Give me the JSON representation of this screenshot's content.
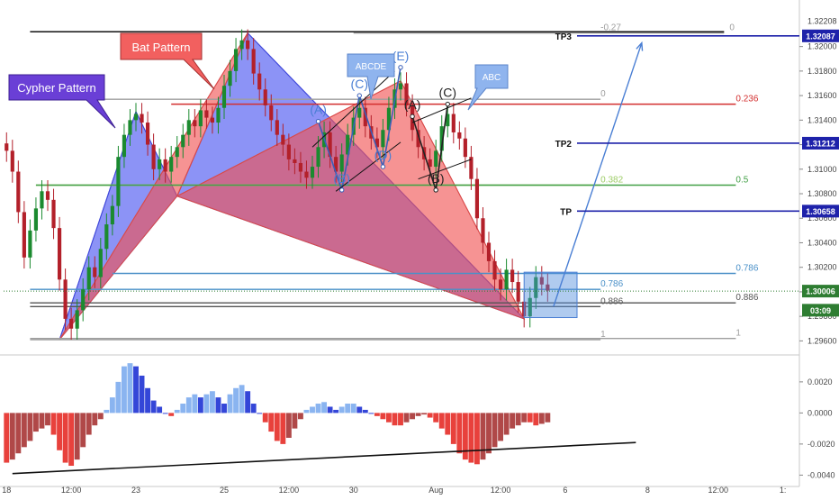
{
  "chart_data": {
    "type": "candlestick",
    "instrument_note": "",
    "price_axis": {
      "ticks": [
        "1.32000",
        "1.31800",
        "1.31600",
        "1.31400",
        "1.31200",
        "1.31000",
        "1.30800",
        "1.30600",
        "1.30400",
        "1.30200",
        "1.30000",
        "1.29800",
        "1.29600"
      ],
      "tick_values": [
        1.32,
        1.318,
        1.316,
        1.314,
        1.312,
        1.31,
        1.308,
        1.306,
        1.304,
        1.302,
        1.3,
        1.298,
        1.296
      ],
      "top_label": "1.32208",
      "range": [
        1.295,
        1.3235
      ]
    },
    "osc_axis": {
      "ticks": [
        "0.0020",
        "0.0000",
        "-0.0020",
        "-0.0040"
      ],
      "tick_values": [
        0.002,
        0.0,
        -0.002,
        -0.004
      ],
      "range": [
        -0.0045,
        0.0035
      ]
    },
    "time_axis": {
      "labels": [
        "18",
        "12:00",
        "23",
        "25",
        "12:00",
        "30",
        "Aug",
        "12:00",
        "6",
        "8",
        "12:00",
        "1:"
      ],
      "label_bars": [
        0,
        11,
        22,
        37,
        48,
        59,
        73,
        84,
        95,
        109,
        121,
        132
      ],
      "total_bars": 135,
      "data_bars": 93
    },
    "price_labels": [
      {
        "text": "1.32087",
        "value": 1.32087,
        "color": "#1e22aa"
      },
      {
        "text": "1.31212",
        "value": 1.31212,
        "color": "#1e22aa"
      },
      {
        "text": "1.30658",
        "value": 1.30658,
        "color": "#1e22aa"
      },
      {
        "text": "1.30006",
        "value": 1.30006,
        "color": "#2e7d32"
      },
      {
        "text": "03:09",
        "value": 1.2985,
        "color": "#2e7d32"
      }
    ],
    "target_lines": [
      {
        "label": "TP3",
        "value": 1.32087,
        "from_bar": 97,
        "color": "#1e22aa"
      },
      {
        "label": "TP2",
        "value": 1.31212,
        "from_bar": 97,
        "color": "#1e22aa"
      },
      {
        "label": "TP",
        "value": 1.30658,
        "from_bar": 97,
        "color": "#1e22aa"
      }
    ],
    "fib_levels": [
      {
        "label": "-0.27",
        "value": 1.3211,
        "color": "#9e9e9e",
        "label_bar": 101,
        "from_bar": 59,
        "to_bar": 122,
        "end_label": "0"
      },
      {
        "label": "0",
        "value": 1.3157,
        "color": "#9e9e9e",
        "label_bar": 101,
        "from_bar": 5,
        "to_bar": 101,
        "end_label": ""
      },
      {
        "label": "0.236",
        "value": 1.3153,
        "color": "#d32f2f",
        "label_bar": 124,
        "from_bar": 28,
        "to_bar": 124,
        "end_label": ""
      },
      {
        "label": "0.382",
        "value": 1.3087,
        "color": "#9ccc65",
        "label_bar": 101,
        "from_bar": 5,
        "to_bar": 101,
        "end_label": ""
      },
      {
        "label": "0.5",
        "value": 1.3087,
        "color": "#43a047",
        "label_bar": 124,
        "from_bar": 5,
        "to_bar": 124,
        "end_label": ""
      },
      {
        "label": "0.786",
        "value": 1.3015,
        "color": "#4a90c8",
        "label_bar": 124,
        "from_bar": 18,
        "to_bar": 124,
        "end_label": ""
      },
      {
        "label": "0.786",
        "value": 1.3002,
        "color": "#4a90c8",
        "label_bar": 101,
        "from_bar": 4,
        "to_bar": 101,
        "end_label": ""
      },
      {
        "label": "0.886",
        "value": 1.2988,
        "color": "#555555",
        "label_bar": 101,
        "from_bar": 4,
        "to_bar": 101,
        "end_label": ""
      },
      {
        "label": "0.886",
        "value": 1.2991,
        "color": "#555555",
        "label_bar": 124,
        "from_bar": 4,
        "to_bar": 124,
        "end_label": ""
      },
      {
        "label": "1",
        "value": 1.2961,
        "color": "#9e9e9e",
        "label_bar": 101,
        "from_bar": 4,
        "to_bar": 101,
        "end_label": ""
      },
      {
        "label": "1",
        "value": 1.2962,
        "color": "#9e9e9e",
        "label_bar": 124,
        "from_bar": 4,
        "to_bar": 124,
        "end_label": ""
      }
    ],
    "top_black_line": {
      "value": 1.3212,
      "from_bar": 4,
      "to_bar": 122
    },
    "patterns": [
      {
        "name": "Cypher Pattern",
        "kind": "blue",
        "points": [
          [
            9,
            1.2961
          ],
          [
            22,
            1.3147
          ],
          [
            29,
            1.3078
          ],
          [
            41,
            1.3211
          ],
          [
            88,
            1.2978
          ]
        ]
      },
      {
        "name": "Bat Pattern",
        "kind": "red",
        "points": [
          [
            9,
            1.2961
          ],
          [
            41,
            1.3211
          ],
          [
            29,
            1.3078
          ],
          [
            67,
            1.3172
          ],
          [
            88,
            1.2978
          ]
        ]
      }
    ],
    "callouts": [
      {
        "text": "Cypher Pattern",
        "style": "purple"
      },
      {
        "text": "Bat Pattern",
        "style": "red"
      },
      {
        "text": "ABCDE",
        "style": "blue"
      },
      {
        "text": "ABC",
        "style": "blue"
      }
    ],
    "wave_labels": [
      {
        "text": "(A)",
        "bar": 53,
        "value": 1.3139,
        "color": "#4a7fd4"
      },
      {
        "text": "(B)",
        "bar": 57,
        "value": 1.3083,
        "color": "#4a7fd4"
      },
      {
        "text": "(C)",
        "bar": 60,
        "value": 1.316,
        "color": "#4a7fd4"
      },
      {
        "text": "(D)",
        "bar": 64,
        "value": 1.3102,
        "color": "#4a7fd4"
      },
      {
        "text": "(E)",
        "bar": 67,
        "value": 1.3183,
        "color": "#4a7fd4"
      },
      {
        "text": "(A)",
        "bar": 69,
        "value": 1.3143,
        "color": "#222222"
      },
      {
        "text": "(B)",
        "bar": 73,
        "value": 1.3083,
        "color": "#222222"
      },
      {
        "text": "(C)",
        "bar": 75,
        "value": 1.3153,
        "color": "#222222"
      }
    ],
    "highlight_box": {
      "from_bar": 88,
      "to_bar": 97,
      "top": 1.3016,
      "bottom": 1.2979
    },
    "projection_arrow": {
      "from_bar": 93,
      "from_value": 1.2988,
      "to_bar": 108,
      "to_value": 1.3203
    },
    "candles_close": [
      1.3115,
      1.3098,
      1.3065,
      1.3028,
      1.305,
      1.3068,
      1.3082,
      1.3075,
      1.3052,
      1.301,
      1.2978,
      1.297,
      1.2985,
      1.3002,
      1.302,
      1.3012,
      1.3035,
      1.3055,
      1.307,
      1.311,
      1.3128,
      1.314,
      1.3145,
      1.3138,
      1.312,
      1.31,
      1.3108,
      1.3098,
      1.311,
      1.3118,
      1.3128,
      1.314,
      1.3135,
      1.3148,
      1.3142,
      1.3138,
      1.315,
      1.3168,
      1.318,
      1.3198,
      1.3205,
      1.3198,
      1.3178,
      1.3165,
      1.3152,
      1.314,
      1.3128,
      1.312,
      1.3108,
      1.3105,
      1.3098,
      1.3093,
      1.3102,
      1.3118,
      1.313,
      1.311,
      1.3098,
      1.3112,
      1.3128,
      1.3142,
      1.315,
      1.3135,
      1.3125,
      1.3118,
      1.3132,
      1.315,
      1.3165,
      1.317,
      1.3152,
      1.3132,
      1.3118,
      1.3108,
      1.3102,
      1.3115,
      1.3135,
      1.3145,
      1.313,
      1.3125,
      1.311,
      1.3092,
      1.306,
      1.304,
      1.3025,
      1.301,
      1.3002,
      1.3018,
      1.3008,
      1.2992,
      1.298,
      1.2995,
      1.3012,
      1.3006,
      1.3001
    ],
    "oscillator": [
      -0.0032,
      -0.003,
      -0.0026,
      -0.0022,
      -0.0018,
      -0.0012,
      -0.001,
      -0.0008,
      -0.0014,
      -0.0024,
      -0.0032,
      -0.0034,
      -0.003,
      -0.0022,
      -0.0014,
      -0.0008,
      -0.0004,
      0.0002,
      0.001,
      0.002,
      0.003,
      0.0032,
      0.003,
      0.0024,
      0.0016,
      0.0008,
      0.0004,
      0.0,
      -0.0002,
      0.0002,
      0.0006,
      0.001,
      0.0012,
      0.001,
      0.0012,
      0.0014,
      0.001,
      0.0006,
      0.0012,
      0.0016,
      0.0018,
      0.0014,
      0.0006,
      0.0,
      -0.0006,
      -0.0012,
      -0.0018,
      -0.002,
      -0.0016,
      -0.001,
      -0.0004,
      0.0002,
      0.0004,
      0.0006,
      0.0007,
      0.0004,
      0.0002,
      0.0004,
      0.0006,
      0.0006,
      0.0004,
      0.0002,
      0.0,
      -0.0002,
      -0.0004,
      -0.0006,
      -0.0008,
      -0.0008,
      -0.0006,
      -0.0004,
      -0.0002,
      -0.0001,
      -0.0003,
      -0.0006,
      -0.001,
      -0.0014,
      -0.002,
      -0.0026,
      -0.003,
      -0.0032,
      -0.0033,
      -0.003,
      -0.0026,
      -0.0022,
      -0.0018,
      -0.0014,
      -0.001,
      -0.0008,
      -0.0006,
      -0.0006,
      -0.0008,
      -0.0007,
      -0.0006
    ],
    "divergence_line": {
      "from_bar": 1,
      "from_value": -0.0039,
      "to_bar": 107,
      "to_value": -0.0019
    }
  }
}
